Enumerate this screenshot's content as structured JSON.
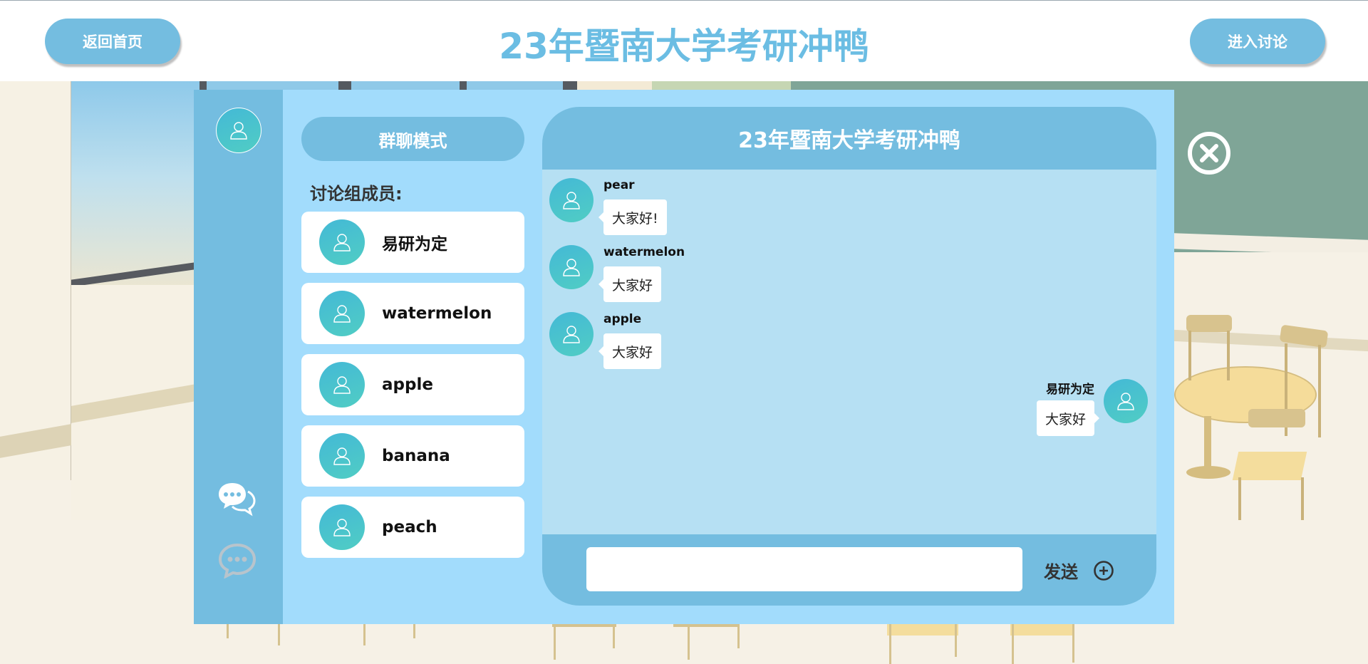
{
  "header": {
    "back_home": "返回首页",
    "title": "23年暨南大学考研冲鸭",
    "enter_discussion": "进入讨论"
  },
  "sidebar": {
    "user_avatar": "user-icon",
    "group_chat_icon": "group-chat-icon",
    "private_chat_icon": "chat-bubble-icon"
  },
  "panel": {
    "mode_label": "群聊模式",
    "members_title": "讨论组成员:",
    "members": [
      {
        "name": "易研为定",
        "avatar": "user-icon"
      },
      {
        "name": "watermelon",
        "avatar": "user-icon"
      },
      {
        "name": "apple",
        "avatar": "user-icon"
      },
      {
        "name": "banana",
        "avatar": "user-icon"
      },
      {
        "name": "peach",
        "avatar": "user-icon"
      }
    ]
  },
  "chat": {
    "title": "23年暨南大学考研冲鸭",
    "messages": [
      {
        "sender": "pear",
        "text": "大家好!",
        "direction": "incoming"
      },
      {
        "sender": "watermelon",
        "text": "大家好",
        "direction": "incoming"
      },
      {
        "sender": "apple",
        "text": "大家好",
        "direction": "incoming"
      },
      {
        "sender": "易研为定",
        "text": "大家好",
        "direction": "outgoing"
      }
    ],
    "input_value": "",
    "send_label": "发送",
    "plus_icon": "plus-circle-icon"
  },
  "close_icon": "close-circle-icon",
  "colors": {
    "primary": "#74bde0",
    "panel": "#a2dcfc",
    "chat_body": "#b6e0f3",
    "title_text": "#6bbde3",
    "avatar": "#44b9d6"
  }
}
